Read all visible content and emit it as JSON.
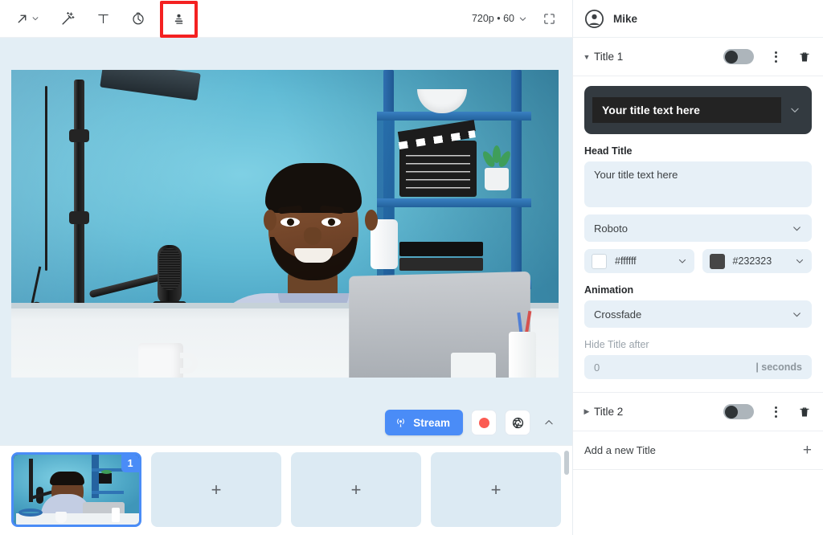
{
  "toolbar": {
    "tools": [
      {
        "name": "pointer-arrow-tool",
        "icon": "arrow-up-right-icon",
        "has_chevron": true
      },
      {
        "name": "magic-wand-tool",
        "icon": "magic-wand-icon",
        "has_chevron": false
      },
      {
        "name": "text-tool",
        "icon": "text-t-icon",
        "has_chevron": false
      },
      {
        "name": "timer-tool",
        "icon": "stopwatch-icon",
        "has_chevron": false
      },
      {
        "name": "title-banner-tool",
        "icon": "lower-third-person-icon",
        "has_chevron": false,
        "highlighted": true
      }
    ],
    "quality_label": "720p • 60",
    "expand_icon": "fullscreen-icon",
    "highlight_color": "#f42121"
  },
  "stage": {
    "controls": {
      "stream_label": "Stream",
      "stream_icon": "broadcast-icon",
      "stream_color": "#4a8cf7",
      "record_icon": "record-dot-icon",
      "record_color": "#fb5b52",
      "settings_icon": "aperture-icon",
      "collapse_icon": "chevron-up-icon"
    },
    "thumbnails": [
      {
        "name": "scene-thumbnail-1",
        "badge": "1",
        "active": true,
        "plus": ""
      },
      {
        "name": "add-scene-slot-2",
        "badge": "",
        "active": false,
        "plus": "+"
      },
      {
        "name": "add-scene-slot-3",
        "badge": "",
        "active": false,
        "plus": "+"
      },
      {
        "name": "add-scene-slot-4",
        "badge": "",
        "active": false,
        "plus": "+"
      }
    ]
  },
  "panel": {
    "user": {
      "name": "Mike",
      "avatar_icon": "account-circle-icon"
    },
    "title1": {
      "label": "Title 1",
      "caret": "▼",
      "toggle_on": false,
      "kebab_icon": "more-vertical-icon",
      "delete_icon": "trash-icon",
      "preview_text": "Your title text here",
      "preview_chevron": "chevron-down-icon",
      "head_title_label": "Head Title",
      "head_title_value": "Your title text here",
      "font_value": "Roboto",
      "text_color": "#ffffff",
      "bg_color": "#232323",
      "animation_label": "Animation",
      "animation_value": "Crossfade",
      "hide_after_label": "Hide Title after",
      "hide_after_value": "0",
      "hide_after_suffix": "| seconds"
    },
    "title2": {
      "label": "Title 2",
      "caret": "▶",
      "toggle_on": false,
      "kebab_icon": "more-vertical-icon",
      "delete_icon": "trash-icon"
    },
    "add_new": {
      "label": "Add a new Title",
      "plus": "+"
    }
  }
}
